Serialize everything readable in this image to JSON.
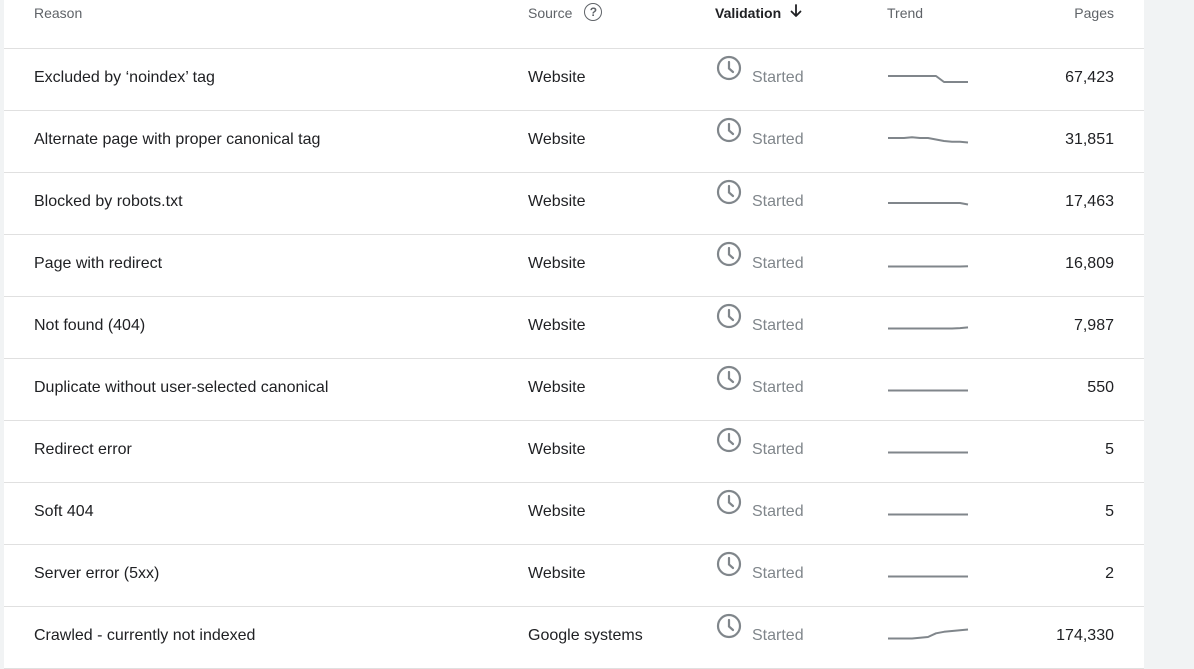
{
  "header": {
    "reason": "Reason",
    "source": "Source",
    "source_help": "?",
    "validation": "Validation",
    "trend": "Trend",
    "pages": "Pages"
  },
  "icons": {
    "help": "help-circle-icon",
    "sort": "arrow-down-icon",
    "status": "clock-icon"
  },
  "colors": {
    "text": "#202124",
    "muted": "#5f6368",
    "status": "#80868b",
    "divider": "#e0e0e0"
  },
  "rows": [
    {
      "reason": "Excluded by ‘noindex’ tag",
      "source": "Website",
      "validation": "Started",
      "pages": "67,423",
      "trend": [
        4,
        4,
        4,
        4,
        4,
        4,
        4,
        0,
        0,
        0,
        0
      ]
    },
    {
      "reason": "Alternate page with proper canonical tag",
      "source": "Website",
      "validation": "Started",
      "pages": "31,851",
      "trend": [
        4,
        4,
        4,
        4.5,
        4,
        4,
        3,
        2,
        1.5,
        1.5,
        1
      ]
    },
    {
      "reason": "Blocked by robots.txt",
      "source": "Website",
      "validation": "Started",
      "pages": "17,463",
      "trend": [
        2,
        2,
        2,
        2,
        2,
        2,
        2,
        2,
        2,
        2,
        1
      ]
    },
    {
      "reason": "Page with redirect",
      "source": "Website",
      "validation": "Started",
      "pages": "16,809",
      "trend": [
        1,
        1,
        1,
        1,
        1,
        1,
        1,
        1,
        1,
        1,
        1.2
      ]
    },
    {
      "reason": "Not found (404)",
      "source": "Website",
      "validation": "Started",
      "pages": "7,987",
      "trend": [
        1,
        1,
        1,
        1,
        1,
        1,
        1,
        1,
        1,
        1.3,
        1.7
      ]
    },
    {
      "reason": "Duplicate without user-selected canonical",
      "source": "Website",
      "validation": "Started",
      "pages": "550",
      "trend": [
        1,
        1,
        1,
        1,
        1,
        1,
        1,
        1,
        1,
        1,
        1
      ]
    },
    {
      "reason": "Redirect error",
      "source": "Website",
      "validation": "Started",
      "pages": "5",
      "trend": [
        1,
        1,
        1,
        1,
        1,
        1,
        1,
        1,
        1,
        1,
        1
      ]
    },
    {
      "reason": "Soft 404",
      "source": "Website",
      "validation": "Started",
      "pages": "5",
      "trend": [
        1,
        1,
        1,
        1,
        1,
        1,
        1,
        1,
        1,
        1,
        1
      ]
    },
    {
      "reason": "Server error (5xx)",
      "source": "Website",
      "validation": "Started",
      "pages": "2",
      "trend": [
        1,
        1,
        1,
        1,
        1,
        1,
        1,
        1,
        1,
        1,
        1
      ]
    },
    {
      "reason": "Crawled - currently not indexed",
      "source": "Google systems",
      "validation": "Started",
      "pages": "174,330",
      "trend": [
        1,
        1,
        1,
        1,
        1.5,
        2,
        4.5,
        5.5,
        6,
        6.5,
        7
      ]
    }
  ]
}
